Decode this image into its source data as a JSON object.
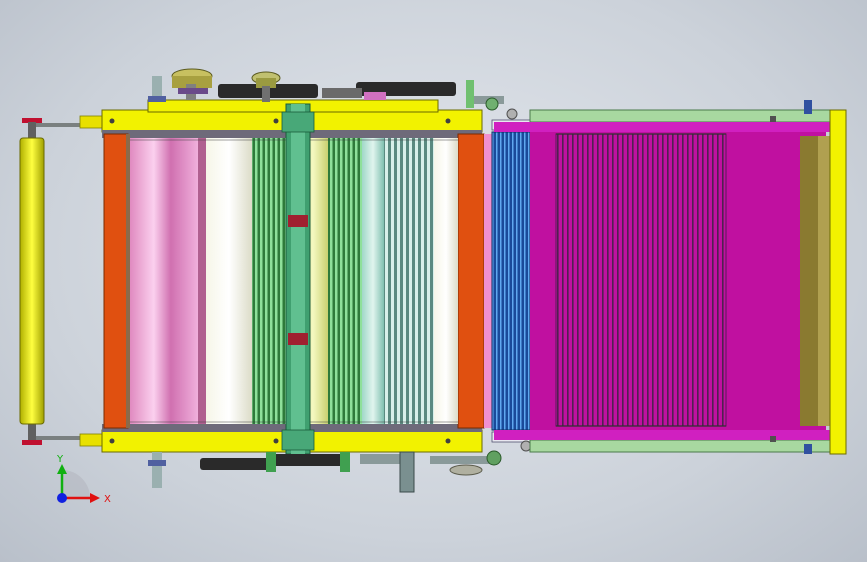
{
  "triad": {
    "x_label": "X",
    "y_label": "Y",
    "x_color": "#e01010",
    "y_color": "#10b010",
    "z_color": "#1020e0"
  },
  "palette": {
    "frame_yellow": "#f2f200",
    "side_orange": "#e05010",
    "conveyor_magenta": "#c010a0",
    "roller_pink": "#f0a0d8",
    "steel_gray": "#8a8f96",
    "dark_belt": "#2a2a2a",
    "olive": "#8a7a30"
  },
  "components": [
    "left-feed-roller",
    "main-machine-frame",
    "drum-roller-section",
    "center-divider-bar",
    "blue-roller",
    "magenta-conveyor-bed",
    "right-end-plate",
    "top-pulleys",
    "bottom-pulleys"
  ]
}
